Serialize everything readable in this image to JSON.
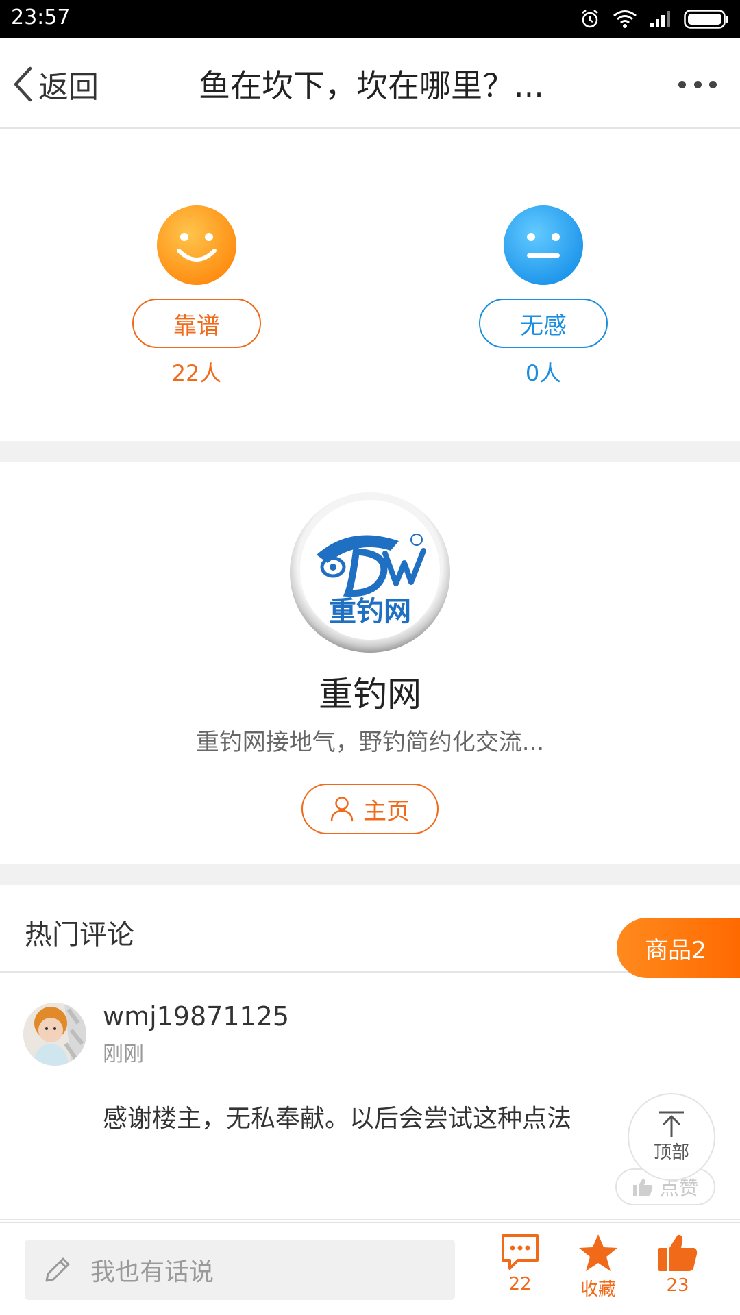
{
  "status_bar": {
    "time": "23:57",
    "icons": [
      "alarm-icon",
      "wifi-icon",
      "signal-icon",
      "battery-icon"
    ]
  },
  "nav": {
    "back_label": "返回",
    "title": "鱼在坎下，坎在哪里？...",
    "more_icon": "more-dots-icon"
  },
  "vote": {
    "agree": {
      "label": "靠谱",
      "count": "22人",
      "color": "#f06a1a",
      "icon": "smile-face-icon"
    },
    "neutral": {
      "label": "无感",
      "count": "0人",
      "color": "#1a8fe0",
      "icon": "neutral-face-icon"
    }
  },
  "author": {
    "logo_text": "重钓网",
    "name": "重钓网",
    "description": "重钓网接地气，野钓简约化交流...",
    "home_label": "主页"
  },
  "comments": {
    "section_title": "热门评论",
    "goods_tab": "商品2",
    "items": [
      {
        "user": "wmj19871125",
        "time": "刚刚",
        "text": "感谢楼主，无私奉献。以后会尝试这种点法",
        "like_label": "点赞"
      }
    ]
  },
  "float": {
    "top_label": "顶部"
  },
  "bottom_bar": {
    "placeholder": "我也有话说",
    "comment_count": "22",
    "favorite_label": "收藏",
    "like_count": "23"
  },
  "colors": {
    "accent": "#f06a1a",
    "blue": "#1a8fe0"
  }
}
